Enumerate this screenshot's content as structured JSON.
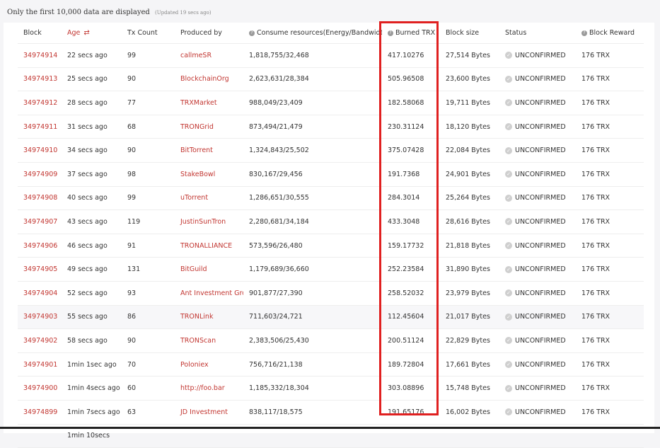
{
  "notice": {
    "text": "Only the first 10,000 data are displayed",
    "updated": "(Updated 19 secs ago)"
  },
  "columns": {
    "block": "Block",
    "age": "Age",
    "tx_count": "Tx Count",
    "produced_by": "Produced by",
    "consume": "Consume resources(Energy/Bandwidth)",
    "burned": "Burned TRX",
    "block_size": "Block size",
    "status": "Status",
    "reward": "Block Reward"
  },
  "icons": {
    "help": "question-circle-icon",
    "sort": "sort-swap-icon",
    "check": "check-circle-icon"
  },
  "colors": {
    "link": "#c23631",
    "highlight_box": "#e02020"
  },
  "rows": [
    {
      "block": "34974914",
      "age": "22 secs ago",
      "tx": "99",
      "producer": "callmeSR",
      "consume": "1,818,755/32,468",
      "burned": "417.10276",
      "size": "27,514 Bytes",
      "status": "UNCONFIRMED",
      "reward": "176 TRX"
    },
    {
      "block": "34974913",
      "age": "25 secs ago",
      "tx": "90",
      "producer": "BlockchainOrg",
      "consume": "2,623,631/28,384",
      "burned": "505.96508",
      "size": "23,600 Bytes",
      "status": "UNCONFIRMED",
      "reward": "176 TRX"
    },
    {
      "block": "34974912",
      "age": "28 secs ago",
      "tx": "77",
      "producer": "TRXMarket",
      "consume": "988,049/23,409",
      "burned": "182.58068",
      "size": "19,711 Bytes",
      "status": "UNCONFIRMED",
      "reward": "176 TRX"
    },
    {
      "block": "34974911",
      "age": "31 secs ago",
      "tx": "68",
      "producer": "TRONGrid",
      "consume": "873,494/21,479",
      "burned": "230.31124",
      "size": "18,120 Bytes",
      "status": "UNCONFIRMED",
      "reward": "176 TRX"
    },
    {
      "block": "34974910",
      "age": "34 secs ago",
      "tx": "90",
      "producer": "BitTorrent",
      "consume": "1,324,843/25,502",
      "burned": "375.07428",
      "size": "22,084 Bytes",
      "status": "UNCONFIRMED",
      "reward": "176 TRX"
    },
    {
      "block": "34974909",
      "age": "37 secs ago",
      "tx": "98",
      "producer": "StakeBowl",
      "consume": "830,167/29,456",
      "burned": "191.7368",
      "size": "24,901 Bytes",
      "status": "UNCONFIRMED",
      "reward": "176 TRX"
    },
    {
      "block": "34974908",
      "age": "40 secs ago",
      "tx": "99",
      "producer": "uTorrent",
      "consume": "1,286,651/30,555",
      "burned": "284.3014",
      "size": "25,264 Bytes",
      "status": "UNCONFIRMED",
      "reward": "176 TRX"
    },
    {
      "block": "34974907",
      "age": "43 secs ago",
      "tx": "119",
      "producer": "JustinSunTron",
      "consume": "2,280,681/34,184",
      "burned": "433.3048",
      "size": "28,616 Bytes",
      "status": "UNCONFIRMED",
      "reward": "176 TRX"
    },
    {
      "block": "34974906",
      "age": "46 secs ago",
      "tx": "91",
      "producer": "TRONALLIANCE",
      "consume": "573,596/26,480",
      "burned": "159.17732",
      "size": "21,818 Bytes",
      "status": "UNCONFIRMED",
      "reward": "176 TRX"
    },
    {
      "block": "34974905",
      "age": "49 secs ago",
      "tx": "131",
      "producer": "BitGuild",
      "consume": "1,179,689/36,660",
      "burned": "252.23584",
      "size": "31,890 Bytes",
      "status": "UNCONFIRMED",
      "reward": "176 TRX"
    },
    {
      "block": "34974904",
      "age": "52 secs ago",
      "tx": "93",
      "producer": "Ant Investment Grc",
      "consume": "901,877/27,390",
      "burned": "258.52032",
      "size": "23,979 Bytes",
      "status": "UNCONFIRMED",
      "reward": "176 TRX"
    },
    {
      "block": "34974903",
      "age": "55 secs ago",
      "tx": "86",
      "producer": "TRONLink",
      "consume": "711,603/24,721",
      "burned": "112.45604",
      "size": "21,017 Bytes",
      "status": "UNCONFIRMED",
      "reward": "176 TRX",
      "highlight": true
    },
    {
      "block": "34974902",
      "age": "58 secs ago",
      "tx": "90",
      "producer": "TRONScan",
      "consume": "2,383,506/25,430",
      "burned": "200.51124",
      "size": "22,829 Bytes",
      "status": "UNCONFIRMED",
      "reward": "176 TRX"
    },
    {
      "block": "34974901",
      "age": "1min 1sec ago",
      "tx": "70",
      "producer": "Poloniex",
      "consume": "756,716/21,138",
      "burned": "189.72804",
      "size": "17,661 Bytes",
      "status": "UNCONFIRMED",
      "reward": "176 TRX"
    },
    {
      "block": "34974900",
      "age": "1min 4secs ago",
      "tx": "60",
      "producer": "http://foo.bar",
      "consume": "1,185,332/18,304",
      "burned": "303.08896",
      "size": "15,748 Bytes",
      "status": "UNCONFIRMED",
      "reward": "176 TRX"
    },
    {
      "block": "34974899",
      "age": "1min 7secs ago",
      "tx": "63",
      "producer": "JD Investment",
      "consume": "838,117/18,575",
      "burned": "191.65176",
      "size": "16,002 Bytes",
      "status": "UNCONFIRMED",
      "reward": "176 TRX"
    },
    {
      "block": "",
      "age": "1min 10secs",
      "tx": "",
      "producer": "",
      "consume": "",
      "burned": "",
      "size": "",
      "status": "",
      "reward": ""
    }
  ]
}
